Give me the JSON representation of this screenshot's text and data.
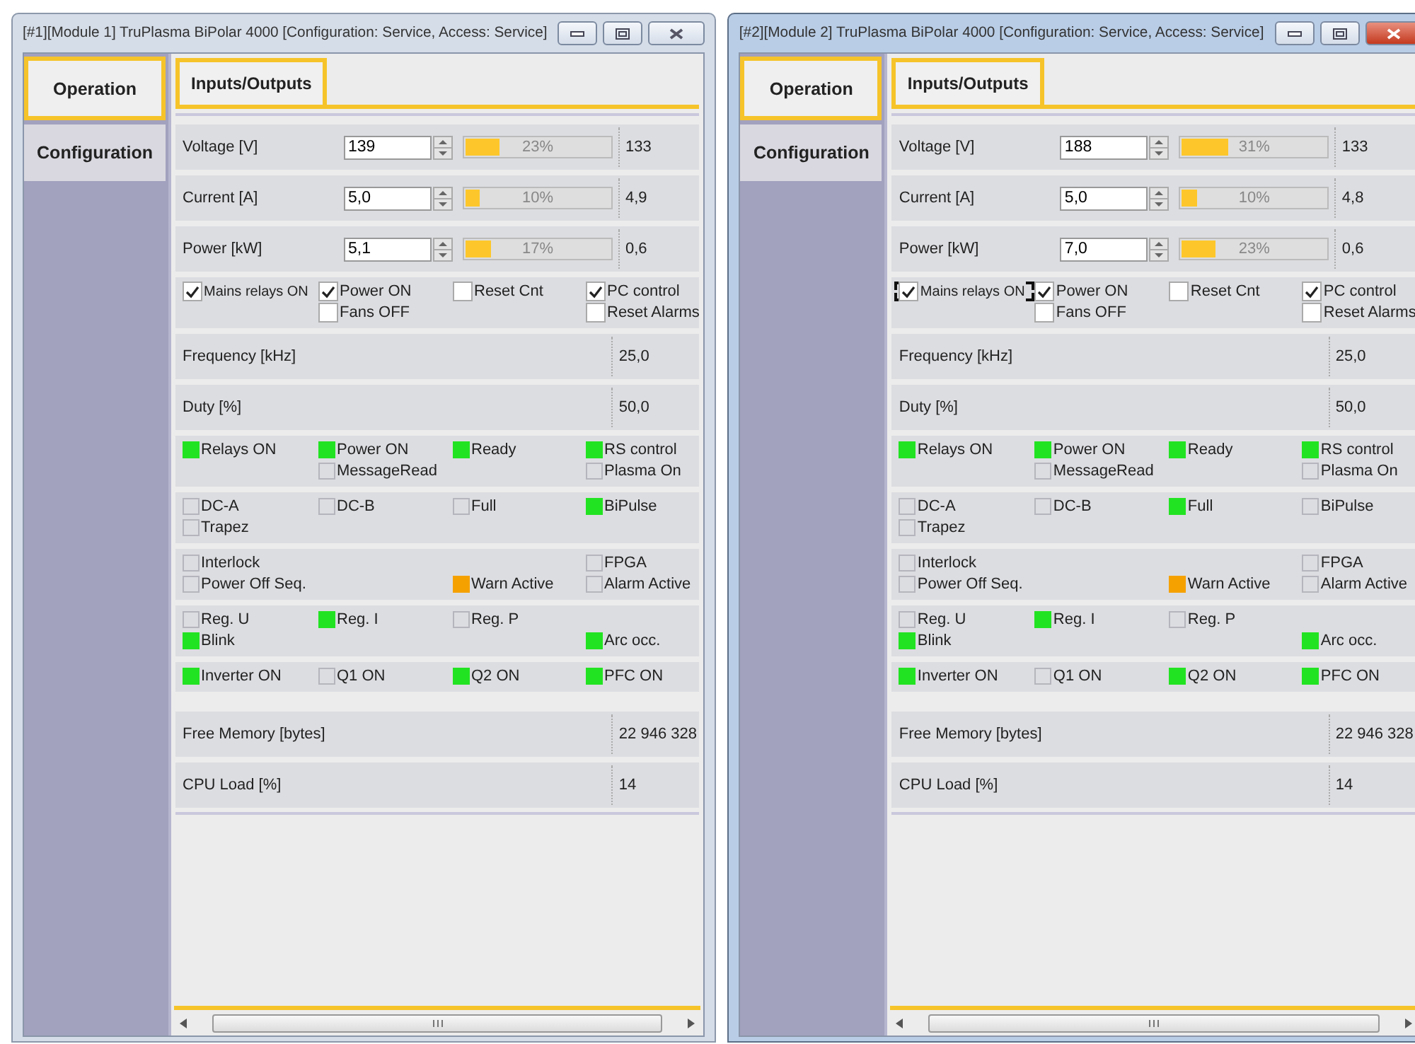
{
  "windows": [
    {
      "title": "[#1][Module 1] TruPlasma BiPolar 4000 [Configuration: Service, Access: Service]",
      "active": false,
      "nav": [
        {
          "label": "Operation",
          "selected": true
        },
        {
          "label": "Configuration",
          "selected": false
        }
      ],
      "tabs": [
        {
          "label": "Inputs/Outputs",
          "selected": true
        }
      ],
      "setpoints": [
        {
          "label": "Voltage [V]",
          "value": "139",
          "level": 0.23,
          "percent": "23%",
          "reading": "133"
        },
        {
          "label": "Current [A]",
          "value": "5,0",
          "level": 0.1,
          "percent": "10%",
          "reading": "4,9"
        },
        {
          "label": "Power [kW]",
          "value": "5,1",
          "level": 0.17,
          "percent": "17%",
          "reading": "0,6"
        }
      ],
      "switches": [
        {
          "column_1": {
            "label": "Mains relays ON",
            "checked": true,
            "focused": false
          },
          "column_2": {
            "label": "Power ON",
            "checked": true,
            "focused": false
          },
          "column_3": {
            "label": "Reset Cnt",
            "checked": false,
            "focused": false
          },
          "column_4": {
            "label": "PC control",
            "checked": true,
            "focused": false
          }
        },
        {
          "column_2": {
            "label": "Fans OFF",
            "checked": false,
            "focused": false
          },
          "column_4": {
            "label": "Reset Alarms",
            "checked": false,
            "focused": false
          }
        }
      ],
      "readouts": [
        {
          "label": "Frequency [kHz]",
          "reading": "25,0"
        },
        {
          "label": "Duty [%]",
          "reading": "50,0"
        }
      ],
      "status_groups": [
        [
          {
            "column_1": {
              "label": "Relays ON",
              "lit": true,
              "color": "#22e322"
            },
            "column_2": {
              "label": "Power ON",
              "lit": true,
              "color": "#22e322"
            },
            "column_3": {
              "label": "Ready",
              "lit": true,
              "color": "#22e322"
            },
            "column_4": {
              "label": "RS control",
              "lit": true,
              "color": "#22e322"
            }
          },
          {
            "column_2": {
              "label": "MessageRead",
              "lit": false
            },
            "column_4": {
              "label": "Plasma On",
              "lit": false
            }
          }
        ],
        [
          {
            "column_1": {
              "label": "DC-A",
              "lit": false
            },
            "column_2": {
              "label": "DC-B",
              "lit": false
            },
            "column_3": {
              "label": "Full",
              "lit": false
            },
            "column_4": {
              "label": "BiPulse",
              "lit": true,
              "color": "#22e322"
            }
          },
          {
            "column_1": {
              "label": "Trapez",
              "lit": false
            }
          }
        ],
        [
          {
            "column_1": {
              "label": "Interlock",
              "lit": false
            },
            "column_4": {
              "label": "FPGA",
              "lit": false
            }
          },
          {
            "column_1": {
              "label": "Power Off Seq.",
              "lit": false
            },
            "column_3": {
              "label": "Warn Active",
              "lit": true,
              "color": "#f5a100"
            },
            "column_4": {
              "label": "Alarm Active",
              "lit": false
            }
          }
        ],
        [
          {
            "column_1": {
              "label": "Reg. U",
              "lit": false
            },
            "column_2": {
              "label": "Reg. I",
              "lit": true,
              "color": "#22e322"
            },
            "column_3": {
              "label": "Reg. P",
              "lit": false
            }
          },
          {
            "column_1": {
              "label": "Blink",
              "lit": true,
              "color": "#22e322"
            },
            "column_4": {
              "label": "Arc occ.",
              "lit": true,
              "color": "#22e322"
            }
          }
        ],
        [
          {
            "column_1": {
              "label": "Inverter ON",
              "lit": true,
              "color": "#22e322"
            },
            "column_2": {
              "label": "Q1 ON",
              "lit": false
            },
            "column_3": {
              "label": "Q2 ON",
              "lit": true,
              "color": "#22e322"
            },
            "column_4": {
              "label": "PFC ON",
              "lit": true,
              "color": "#22e322"
            }
          }
        ]
      ],
      "system": [
        {
          "label": "Free Memory [bytes]",
          "reading": "22 946 328"
        },
        {
          "label": "CPU Load [%]",
          "reading": "14"
        }
      ]
    },
    {
      "title": "[#2][Module 2] TruPlasma BiPolar 4000 [Configuration: Service, Access: Service]",
      "active": true,
      "nav": [
        {
          "label": "Operation",
          "selected": true
        },
        {
          "label": "Configuration",
          "selected": false
        }
      ],
      "tabs": [
        {
          "label": "Inputs/Outputs",
          "selected": true
        }
      ],
      "setpoints": [
        {
          "label": "Voltage [V]",
          "value": "188",
          "level": 0.31,
          "percent": "31%",
          "reading": "133"
        },
        {
          "label": "Current [A]",
          "value": "5,0",
          "level": 0.1,
          "percent": "10%",
          "reading": "4,8"
        },
        {
          "label": "Power [kW]",
          "value": "7,0",
          "level": 0.23,
          "percent": "23%",
          "reading": "0,6"
        }
      ],
      "switches": [
        {
          "column_1": {
            "label": "Mains relays ON",
            "checked": true,
            "focused": true
          },
          "column_2": {
            "label": "Power ON",
            "checked": true,
            "focused": false
          },
          "column_3": {
            "label": "Reset Cnt",
            "checked": false,
            "focused": false
          },
          "column_4": {
            "label": "PC control",
            "checked": true,
            "focused": false
          }
        },
        {
          "column_2": {
            "label": "Fans OFF",
            "checked": false,
            "focused": false
          },
          "column_4": {
            "label": "Reset Alarms",
            "checked": false,
            "focused": false
          }
        }
      ],
      "readouts": [
        {
          "label": "Frequency [kHz]",
          "reading": "25,0"
        },
        {
          "label": "Duty [%]",
          "reading": "50,0"
        }
      ],
      "status_groups": [
        [
          {
            "column_1": {
              "label": "Relays ON",
              "lit": true,
              "color": "#22e322"
            },
            "column_2": {
              "label": "Power ON",
              "lit": true,
              "color": "#22e322"
            },
            "column_3": {
              "label": "Ready",
              "lit": true,
              "color": "#22e322"
            },
            "column_4": {
              "label": "RS control",
              "lit": true,
              "color": "#22e322"
            }
          },
          {
            "column_2": {
              "label": "MessageRead",
              "lit": false
            },
            "column_4": {
              "label": "Plasma On",
              "lit": false
            }
          }
        ],
        [
          {
            "column_1": {
              "label": "DC-A",
              "lit": false
            },
            "column_2": {
              "label": "DC-B",
              "lit": false
            },
            "column_3": {
              "label": "Full",
              "lit": true,
              "color": "#22e322"
            },
            "column_4": {
              "label": "BiPulse",
              "lit": false
            }
          },
          {
            "column_1": {
              "label": "Trapez",
              "lit": false
            }
          }
        ],
        [
          {
            "column_1": {
              "label": "Interlock",
              "lit": false
            },
            "column_4": {
              "label": "FPGA",
              "lit": false
            }
          },
          {
            "column_1": {
              "label": "Power Off Seq.",
              "lit": false
            },
            "column_3": {
              "label": "Warn Active",
              "lit": true,
              "color": "#f5a100"
            },
            "column_4": {
              "label": "Alarm Active",
              "lit": false
            }
          }
        ],
        [
          {
            "column_1": {
              "label": "Reg. U",
              "lit": false
            },
            "column_2": {
              "label": "Reg. I",
              "lit": true,
              "color": "#22e322"
            },
            "column_3": {
              "label": "Reg. P",
              "lit": false
            }
          },
          {
            "column_1": {
              "label": "Blink",
              "lit": true,
              "color": "#22e322"
            },
            "column_4": {
              "label": "Arc occ.",
              "lit": true,
              "color": "#22e322"
            }
          }
        ],
        [
          {
            "column_1": {
              "label": "Inverter ON",
              "lit": true,
              "color": "#22e322"
            },
            "column_2": {
              "label": "Q1 ON",
              "lit": false
            },
            "column_3": {
              "label": "Q2 ON",
              "lit": true,
              "color": "#22e322"
            },
            "column_4": {
              "label": "PFC ON",
              "lit": true,
              "color": "#22e322"
            }
          }
        ]
      ],
      "system": [
        {
          "label": "Free Memory [bytes]",
          "reading": "22 946 328"
        },
        {
          "label": "CPU Load [%]",
          "reading": "14"
        }
      ]
    }
  ]
}
